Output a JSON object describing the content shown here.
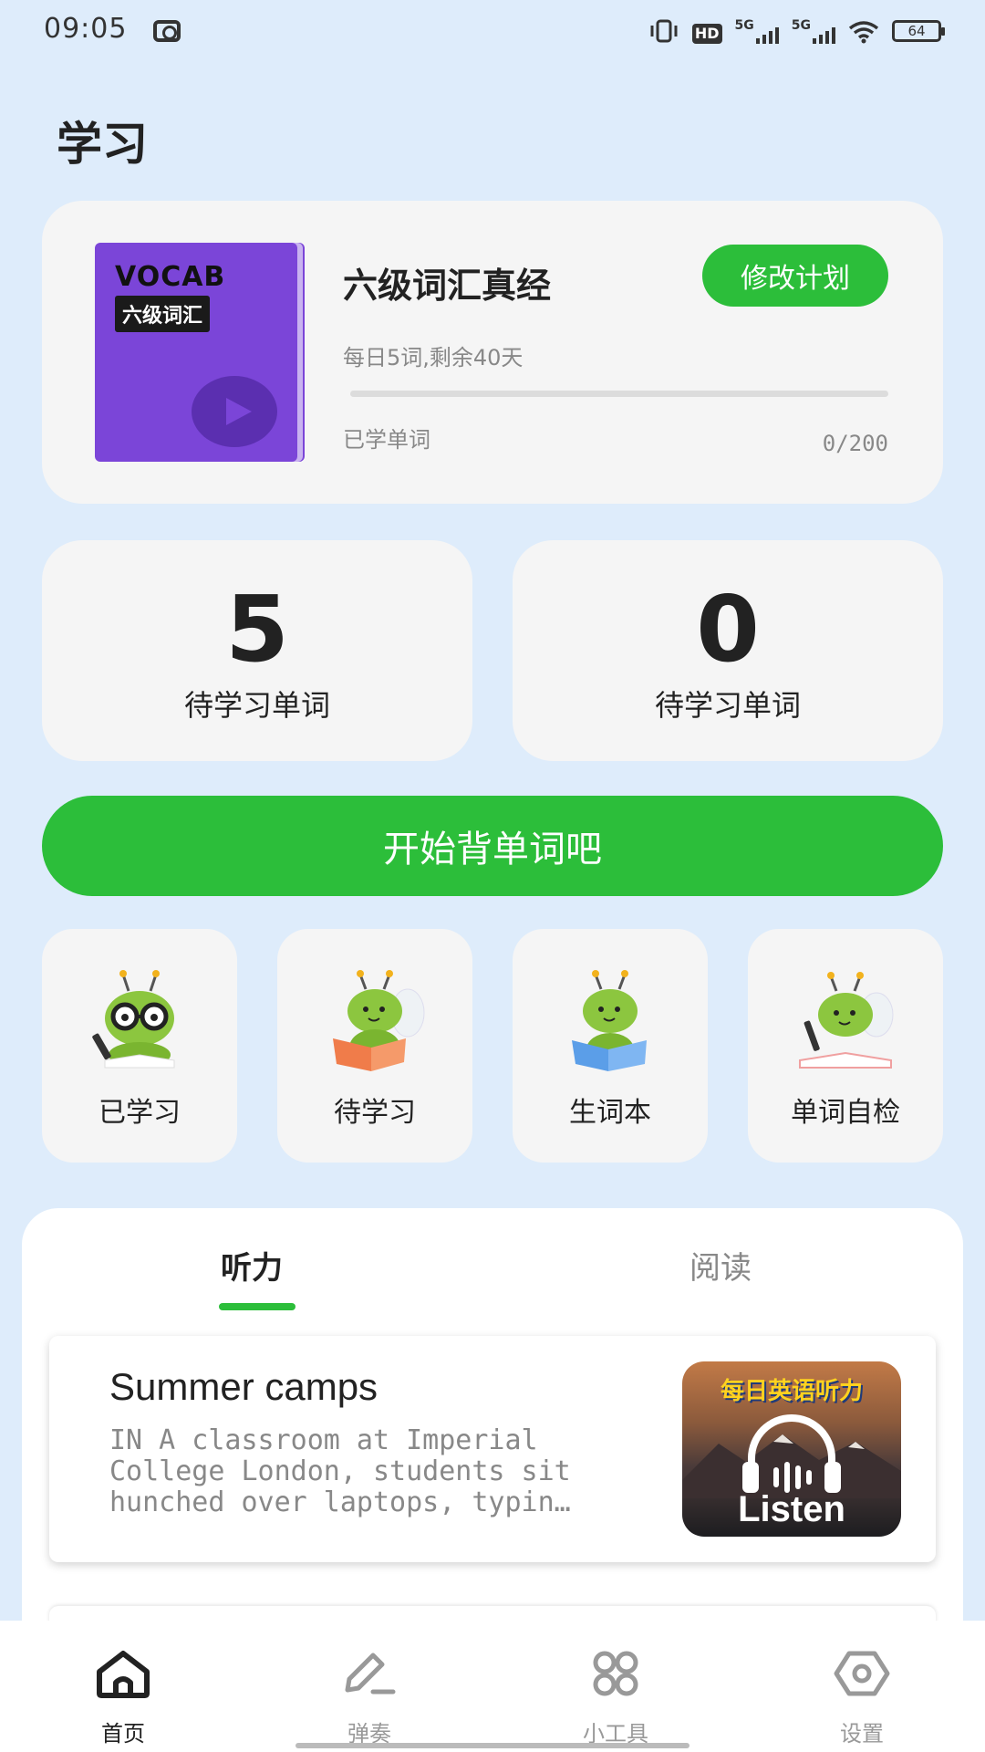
{
  "status_bar": {
    "time": "09:05",
    "battery": "64",
    "network_1": "5G",
    "network_2": "5G",
    "hd_label": "HD"
  },
  "page_title": "学习",
  "plan": {
    "book_cover_title": "VOCAB",
    "book_cover_subtitle": "六级词汇",
    "name": "六级词汇真经",
    "edit_button": "修改计划",
    "daily_text": "每日5词,剩余40天",
    "learned_label": "已学单词",
    "learned_count": "0/200",
    "progress_fraction": 0
  },
  "stats": [
    {
      "value": "5",
      "label": "待学习单词"
    },
    {
      "value": "0",
      "label": "待学习单词"
    }
  ],
  "start_button": "开始背单词吧",
  "tiles": [
    {
      "label": "已学习",
      "icon": "bee-glasses-icon"
    },
    {
      "label": "待学习",
      "icon": "bee-reading-icon"
    },
    {
      "label": "生词本",
      "icon": "bee-book-icon"
    },
    {
      "label": "单词自检",
      "icon": "bee-writing-icon"
    }
  ],
  "tabs": {
    "listen": "听力",
    "read": "阅读",
    "active": "listen"
  },
  "article": {
    "title": "Summer camps",
    "excerpt": "IN A classroom at Imperial College London, students sit hunched over laptops, typin…",
    "thumb_title": "每日英语听力",
    "thumb_caption": "Listen"
  },
  "bottom_nav": [
    {
      "label": "首页",
      "icon": "home-icon",
      "active": true
    },
    {
      "label": "弹奏",
      "icon": "pen-icon",
      "active": false
    },
    {
      "label": "小工具",
      "icon": "grid-icon",
      "active": false
    },
    {
      "label": "设置",
      "icon": "hexagon-settings-icon",
      "active": false
    }
  ],
  "colors": {
    "background": "#deecfb",
    "accent_green": "#2cbe3a",
    "book_purple": "#7b45d8",
    "card": "#f5f5f5"
  }
}
